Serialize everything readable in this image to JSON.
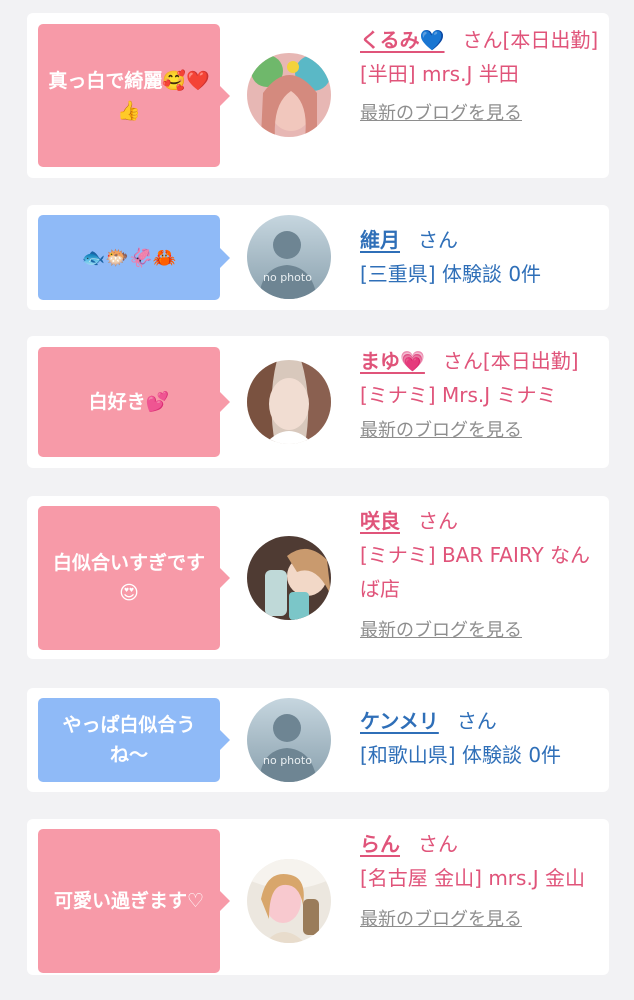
{
  "posts": [
    {
      "comment": "真っ白で綺麗🥰❤️👍",
      "name": "くるみ💙",
      "honorific": "さん",
      "status": "[本日出勤]",
      "shop": "[半田] mrs.J 半田",
      "link": "最新のブログを見る",
      "bubble_color": "#f79aa8"
    },
    {
      "comment": "🐟🐡🦑🦀",
      "name": "維月",
      "honorific": "さん",
      "shop": "[三重県] 体験談 0件",
      "avatar_text": "no photo",
      "bubble_color": "#8fbaf7"
    },
    {
      "comment": "白好き💕",
      "name": "まゆ💗",
      "honorific": "さん",
      "status": "[本日出勤]",
      "shop": "[ミナミ] Mrs.J ミナミ",
      "link": "最新のブログを見る",
      "bubble_color": "#f79aa8"
    },
    {
      "comment": "白似合いすぎです😍",
      "name": "咲良",
      "honorific": "さん",
      "shop": "[ミナミ] BAR FAIRY なんば店",
      "link": "最新のブログを見る",
      "bubble_color": "#f79aa8"
    },
    {
      "comment": "やっぱ白似合うね〜",
      "name": "ケンメリ",
      "honorific": "さん",
      "shop": "[和歌山県] 体験談 0件",
      "avatar_text": "no photo",
      "bubble_color": "#8fbaf7"
    },
    {
      "comment": "可愛い過ぎます♡",
      "name": "らん",
      "honorific": "さん",
      "shop": "[名古屋 金山] mrs.J 金山",
      "link": "最新のブログを見る",
      "bubble_color": "#f79aa8"
    }
  ]
}
